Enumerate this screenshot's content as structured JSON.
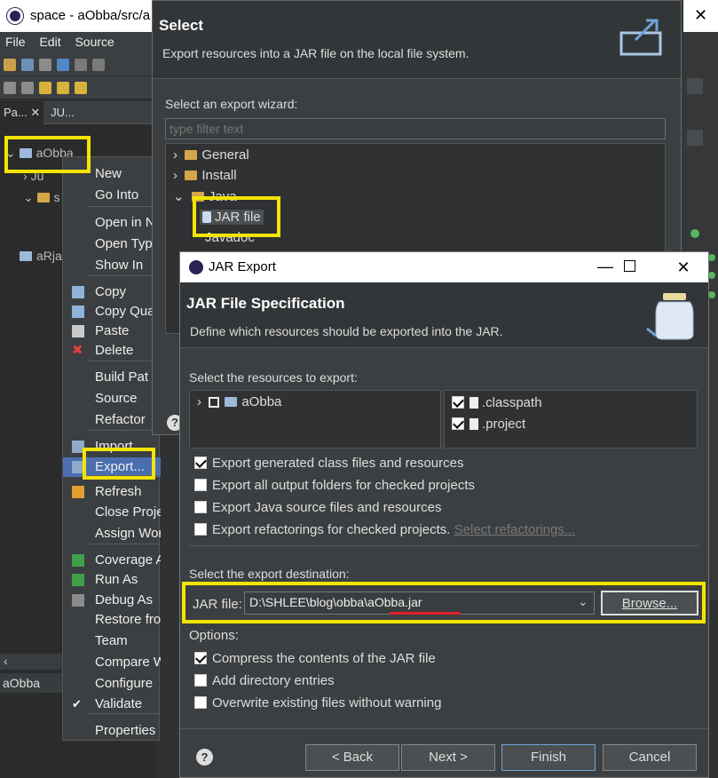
{
  "eclipse": {
    "title": "space - aObba/src/a",
    "menu": [
      "File",
      "Edit",
      "Source"
    ],
    "tabs": [
      "Pa...",
      "JU..."
    ],
    "project": "aObba",
    "tree_extra": [
      "Ju",
      "s",
      "aRja"
    ],
    "status_project": "aObba"
  },
  "context_menu": {
    "items": [
      {
        "label": "New",
        "icon": ""
      },
      {
        "label": "Go Into",
        "icon": ""
      },
      {
        "label": "Open in N",
        "icon": ""
      },
      {
        "label": "Open Typ",
        "icon": ""
      },
      {
        "label": "Show In",
        "icon": ""
      },
      {
        "label": "Copy",
        "icon": "copy-icon"
      },
      {
        "label": "Copy Qua",
        "icon": "copy-qualified-icon"
      },
      {
        "label": "Paste",
        "icon": "paste-icon"
      },
      {
        "label": "Delete",
        "icon": "delete-icon"
      },
      {
        "label": "Build Pat",
        "icon": ""
      },
      {
        "label": "Source",
        "icon": ""
      },
      {
        "label": "Refactor",
        "icon": ""
      },
      {
        "label": "Import...",
        "icon": "import-icon"
      },
      {
        "label": "Export...",
        "icon": "export-icon"
      },
      {
        "label": "Refresh",
        "icon": "refresh-icon"
      },
      {
        "label": "Close Project",
        "icon": ""
      },
      {
        "label": "Assign Workin",
        "icon": ""
      },
      {
        "label": "Coverage As",
        "icon": "coverage-icon"
      },
      {
        "label": "Run As",
        "icon": "run-icon"
      },
      {
        "label": "Debug As",
        "icon": "debug-icon"
      },
      {
        "label": "Restore from",
        "icon": ""
      },
      {
        "label": "Team",
        "icon": ""
      },
      {
        "label": "Compare With",
        "icon": ""
      },
      {
        "label": "Configure",
        "icon": ""
      },
      {
        "label": "Validate",
        "icon": "check-icon"
      },
      {
        "label": "Properties",
        "icon": ""
      }
    ]
  },
  "select_dialog": {
    "title": "Select",
    "description": "Export resources into a JAR file on the local file system.",
    "wizard_label": "Select an export wizard:",
    "filter_placeholder": "type filter text",
    "tree": [
      "General",
      "Install",
      "Java",
      "JAR file",
      "Javadoc"
    ]
  },
  "jar_dialog": {
    "window_title": "JAR Export",
    "header_title": "JAR File Specification",
    "header_desc": "Define which resources should be exported into the JAR.",
    "resources_label": "Select the resources to export:",
    "resource_project": "aObba",
    "files": [
      ".classpath",
      ".project"
    ],
    "options_top": [
      {
        "label": "Export generated class files and resources",
        "checked": true
      },
      {
        "label": "Export all output folders for checked projects",
        "checked": false
      },
      {
        "label": "Export Java source files and resources",
        "checked": false
      },
      {
        "label": "Export refactorings for checked projects.",
        "checked": false
      }
    ],
    "select_refactorings": "Select refactorings...",
    "destination_label": "Select the export destination:",
    "jar_file_label": "JAR file:",
    "jar_file_value": "D:\\SHLEE\\blog\\obba\\aObba.jar",
    "browse": "Browse...",
    "options_label": "Options:",
    "options_bottom": [
      {
        "label": "Compress the contents of the JAR file",
        "checked": true
      },
      {
        "label": "Add directory entries",
        "checked": false
      },
      {
        "label": "Overwrite existing files without warning",
        "checked": false
      }
    ],
    "buttons": {
      "back": "< Back",
      "next": "Next >",
      "finish": "Finish",
      "cancel": "Cancel"
    },
    "help": "?"
  },
  "colors": {
    "highlight": "#f2e500",
    "underline": "#e0202a",
    "accent": "#4a9fd5"
  }
}
